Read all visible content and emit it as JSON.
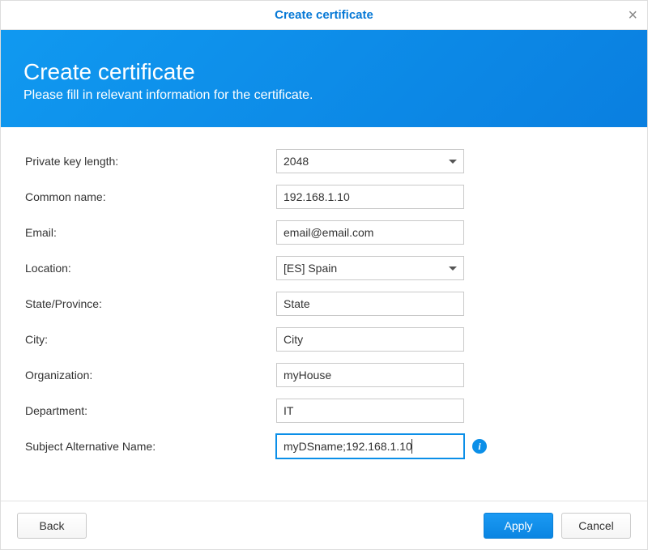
{
  "titlebar": {
    "title": "Create certificate"
  },
  "banner": {
    "title": "Create certificate",
    "subtitle": "Please fill in relevant information for the certificate."
  },
  "form": {
    "private_key_length": {
      "label": "Private key length:",
      "value": "2048"
    },
    "common_name": {
      "label": "Common name:",
      "value": "192.168.1.10"
    },
    "email": {
      "label": "Email:",
      "value": "email@email.com"
    },
    "location": {
      "label": "Location:",
      "value": "[ES] Spain"
    },
    "state": {
      "label": "State/Province:",
      "value": "State"
    },
    "city": {
      "label": "City:",
      "value": "City"
    },
    "organization": {
      "label": "Organization:",
      "value": "myHouse"
    },
    "department": {
      "label": "Department:",
      "value": "IT"
    },
    "san": {
      "label": "Subject Alternative Name:",
      "value": "myDSname;192.168.1.10"
    }
  },
  "footer": {
    "back": "Back",
    "apply": "Apply",
    "cancel": "Cancel"
  }
}
